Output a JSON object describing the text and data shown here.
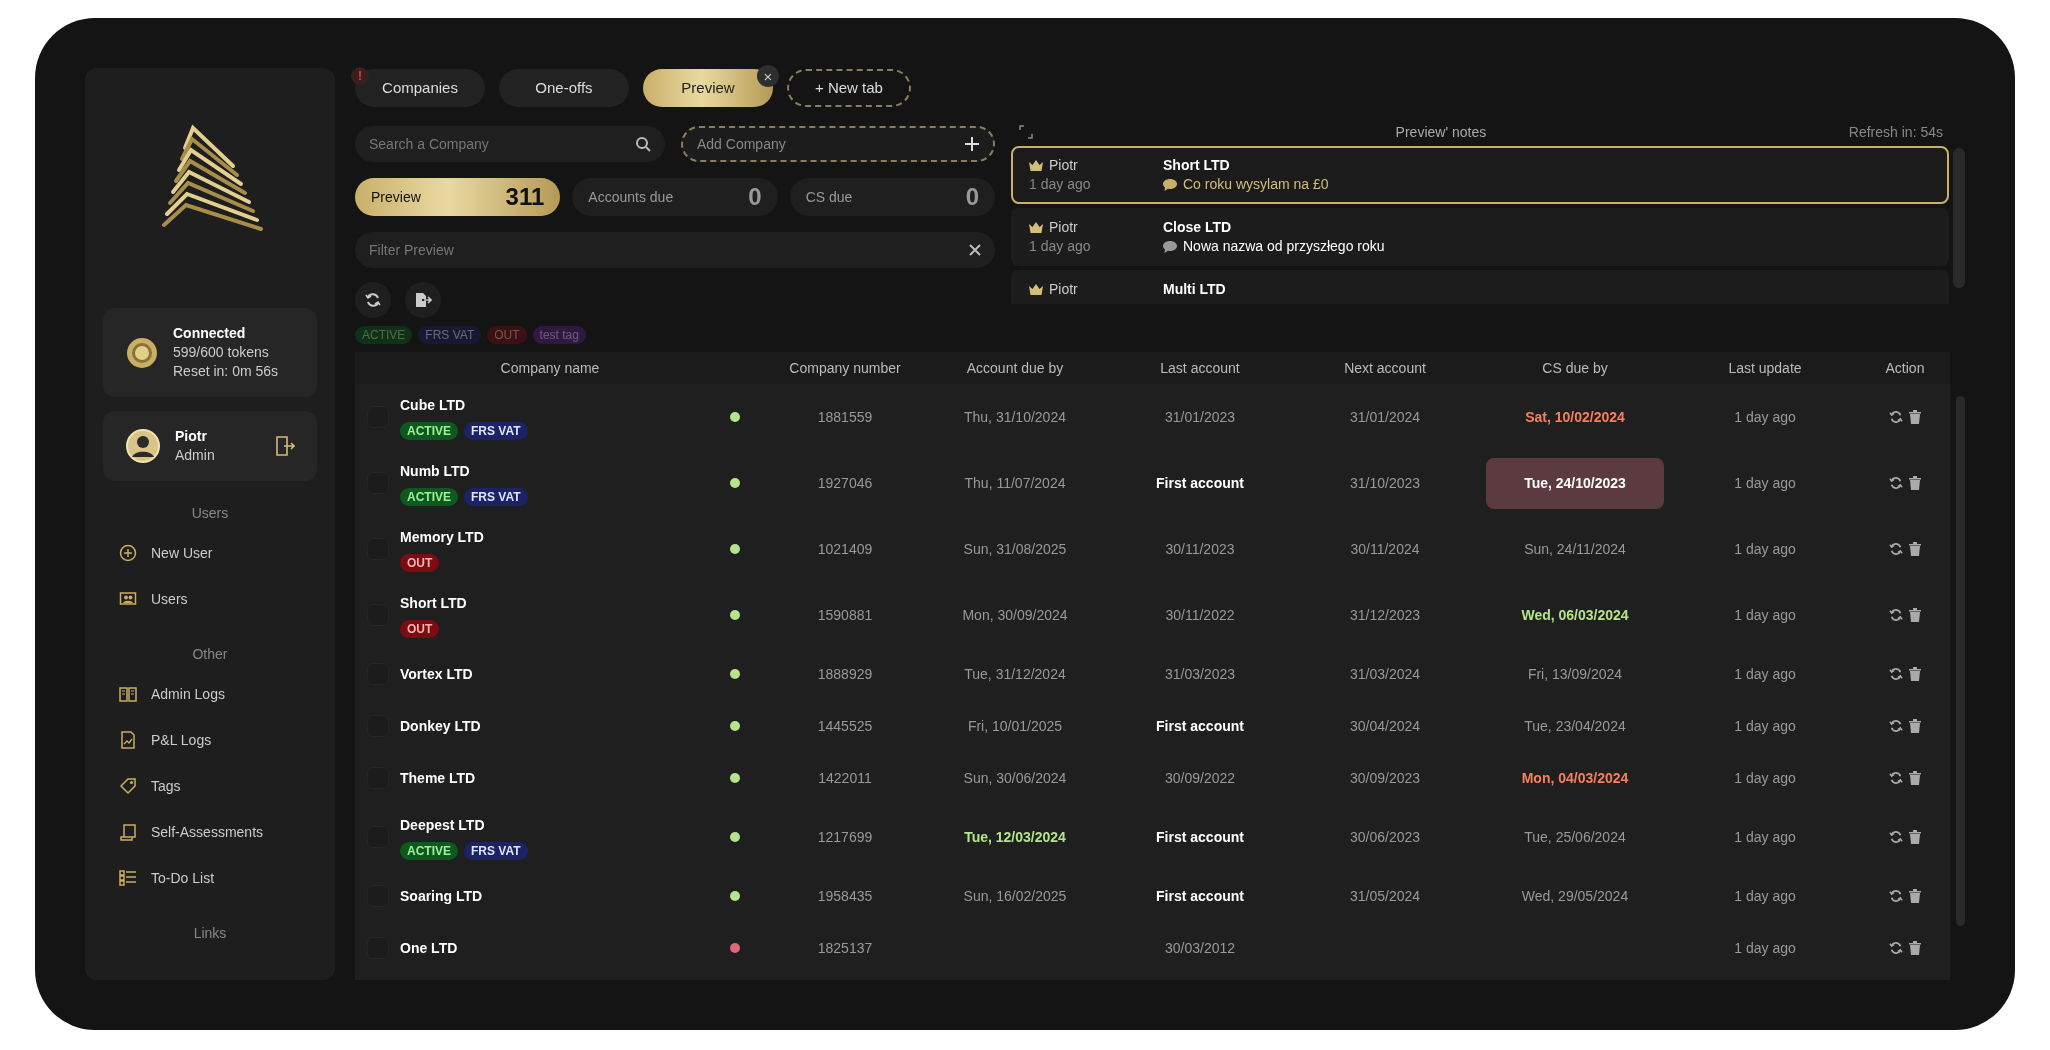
{
  "sidebar": {
    "status": {
      "title": "Connected",
      "tokens": "599/600 tokens",
      "reset": "Reset in: 0m 56s"
    },
    "user": {
      "name": "Piotr",
      "role": "Admin"
    },
    "sections": [
      {
        "heading": "Users",
        "items": [
          {
            "label": "New User",
            "kind": "plus"
          },
          {
            "label": "Users",
            "kind": "users"
          }
        ]
      },
      {
        "heading": "Other",
        "items": [
          {
            "label": "Admin Logs",
            "kind": "book"
          },
          {
            "label": "P&L Logs",
            "kind": "doc"
          },
          {
            "label": "Tags",
            "kind": "tag"
          },
          {
            "label": "Self-Assessments",
            "kind": "scroll"
          },
          {
            "label": "To-Do List",
            "kind": "list"
          }
        ]
      },
      {
        "heading": "Links"
      }
    ]
  },
  "tabs": [
    {
      "label": "Companies",
      "selected": false,
      "alert": "!"
    },
    {
      "label": "One-offs",
      "selected": false
    },
    {
      "label": "Preview",
      "selected": true,
      "close": "×"
    }
  ],
  "new_tab": "+ New tab",
  "search": {
    "placeholder": "Search a Company"
  },
  "add_company": {
    "placeholder": "Add Company"
  },
  "counters": [
    {
      "label": "Preview",
      "count": "311",
      "selected": true
    },
    {
      "label": "Accounts due",
      "count": "0",
      "selected": false
    },
    {
      "label": "CS due",
      "count": "0",
      "selected": false
    }
  ],
  "filter": {
    "placeholder": "Filter Preview"
  },
  "tag_filters": [
    {
      "label": "ACTIVE",
      "kind": "active"
    },
    {
      "label": "FRS VAT",
      "kind": "frs"
    },
    {
      "label": "OUT",
      "kind": "out"
    },
    {
      "label": "test tag",
      "kind": "test"
    }
  ],
  "notes": {
    "title": "Preview' notes",
    "refresh": "Refresh in: 54s",
    "items": [
      {
        "author": "Piotr",
        "time": "1 day ago",
        "company": "Short LTD",
        "text": "Co roku wysylam na £0",
        "selected": true
      },
      {
        "author": "Piotr",
        "time": "1 day ago",
        "company": "Close LTD",
        "text": "Nowa nazwa od przyszłego roku",
        "selected": false
      },
      {
        "author": "Piotr",
        "company": "Multi LTD",
        "selected": false
      }
    ]
  },
  "table": {
    "columns": [
      "Company name",
      "Company number",
      "Account due by",
      "Last account",
      "Next account",
      "CS due by",
      "Last update",
      "Action"
    ],
    "rows": [
      {
        "name": "Cube LTD",
        "checked": false,
        "tags": [
          {
            "label": "ACTIVE",
            "kind": "active"
          },
          {
            "label": "FRS VAT",
            "kind": "frs"
          }
        ],
        "color": "#b5e58a",
        "number": "1881559",
        "account_due": {
          "text": "Thu, 31/10/2024",
          "kind": "normal"
        },
        "last_account": {
          "text": "31/01/2023",
          "kind": "normal"
        },
        "next_account": "31/01/2024",
        "cs_due": {
          "text": "Sat, 10/02/2024",
          "kind": "overdue"
        },
        "updated": "1 day ago"
      },
      {
        "name": "Numb LTD",
        "checked": false,
        "tags": [
          {
            "label": "ACTIVE",
            "kind": "active"
          },
          {
            "label": "FRS VAT",
            "kind": "frs"
          }
        ],
        "color": "#b5e58a",
        "number": "1927046",
        "account_due": {
          "text": "Thu, 11/07/2024",
          "kind": "normal"
        },
        "last_account": {
          "text": "First account",
          "kind": "first"
        },
        "next_account": "31/10/2023",
        "cs_due": {
          "text": "Tue, 24/10/2023",
          "kind": "urgent"
        },
        "updated": "1 day ago"
      },
      {
        "name": "Memory LTD",
        "checked": false,
        "tags": [
          {
            "label": "OUT",
            "kind": "out"
          }
        ],
        "color": "#b5e58a",
        "number": "1021409",
        "account_due": {
          "text": "Sun, 31/08/2025",
          "kind": "normal"
        },
        "last_account": {
          "text": "30/11/2023",
          "kind": "normal"
        },
        "next_account": "30/11/2024",
        "cs_due": {
          "text": "Sun, 24/11/2024",
          "kind": "normal"
        },
        "updated": "1 day ago"
      },
      {
        "name": "Short LTD",
        "checked": false,
        "tags": [
          {
            "label": "OUT",
            "kind": "out"
          }
        ],
        "color": "#b5e58a",
        "number": "1590881",
        "account_due": {
          "text": "Mon, 30/09/2024",
          "kind": "normal"
        },
        "last_account": {
          "text": "30/11/2022",
          "kind": "normal"
        },
        "next_account": "31/12/2023",
        "cs_due": {
          "text": "Wed, 06/03/2024",
          "kind": "soon"
        },
        "updated": "1 day ago"
      },
      {
        "name": "Vortex LTD",
        "checked": false,
        "tags": [],
        "color": "#b5e58a",
        "number": "1888929",
        "account_due": {
          "text": "Tue, 31/12/2024",
          "kind": "normal"
        },
        "last_account": {
          "text": "31/03/2023",
          "kind": "normal"
        },
        "next_account": "31/03/2024",
        "cs_due": {
          "text": "Fri, 13/09/2024",
          "kind": "normal"
        },
        "updated": "1 day ago"
      },
      {
        "name": "Donkey LTD",
        "checked": false,
        "tags": [],
        "color": "#b5e58a",
        "number": "1445525",
        "account_due": {
          "text": "Fri, 10/01/2025",
          "kind": "normal"
        },
        "last_account": {
          "text": "First account",
          "kind": "first"
        },
        "next_account": "30/04/2024",
        "cs_due": {
          "text": "Tue, 23/04/2024",
          "kind": "normal"
        },
        "updated": "1 day ago"
      },
      {
        "name": "Theme LTD",
        "checked": false,
        "tags": [],
        "color": "#b5e58a",
        "number": "1422011",
        "account_due": {
          "text": "Sun, 30/06/2024",
          "kind": "normal"
        },
        "last_account": {
          "text": "30/09/2022",
          "kind": "normal"
        },
        "next_account": "30/09/2023",
        "cs_due": {
          "text": "Mon, 04/03/2024",
          "kind": "overdue"
        },
        "updated": "1 day ago"
      },
      {
        "name": "Deepest LTD",
        "checked": false,
        "tags": [
          {
            "label": "ACTIVE",
            "kind": "active"
          },
          {
            "label": "FRS VAT",
            "kind": "frs"
          }
        ],
        "color": "#b5e58a",
        "number": "1217699",
        "account_due": {
          "text": "Tue, 12/03/2024",
          "kind": "soon"
        },
        "last_account": {
          "text": "First account",
          "kind": "first"
        },
        "next_account": "30/06/2023",
        "cs_due": {
          "text": "Tue, 25/06/2024",
          "kind": "normal"
        },
        "updated": "1 day ago"
      },
      {
        "name": "Soaring LTD",
        "checked": false,
        "tags": [],
        "color": "#b5e58a",
        "number": "1958435",
        "account_due": {
          "text": "Sun, 16/02/2025",
          "kind": "normal"
        },
        "last_account": {
          "text": "First account",
          "kind": "first"
        },
        "next_account": "31/05/2024",
        "cs_due": {
          "text": "Wed, 29/05/2024",
          "kind": "normal"
        },
        "updated": "1 day ago"
      },
      {
        "name": "One LTD",
        "checked": false,
        "tags": [],
        "color": "#e0667a",
        "number": "1825137",
        "last_account": {
          "text": "30/03/2012",
          "kind": "normal"
        },
        "updated": "1 day ago"
      }
    ]
  }
}
